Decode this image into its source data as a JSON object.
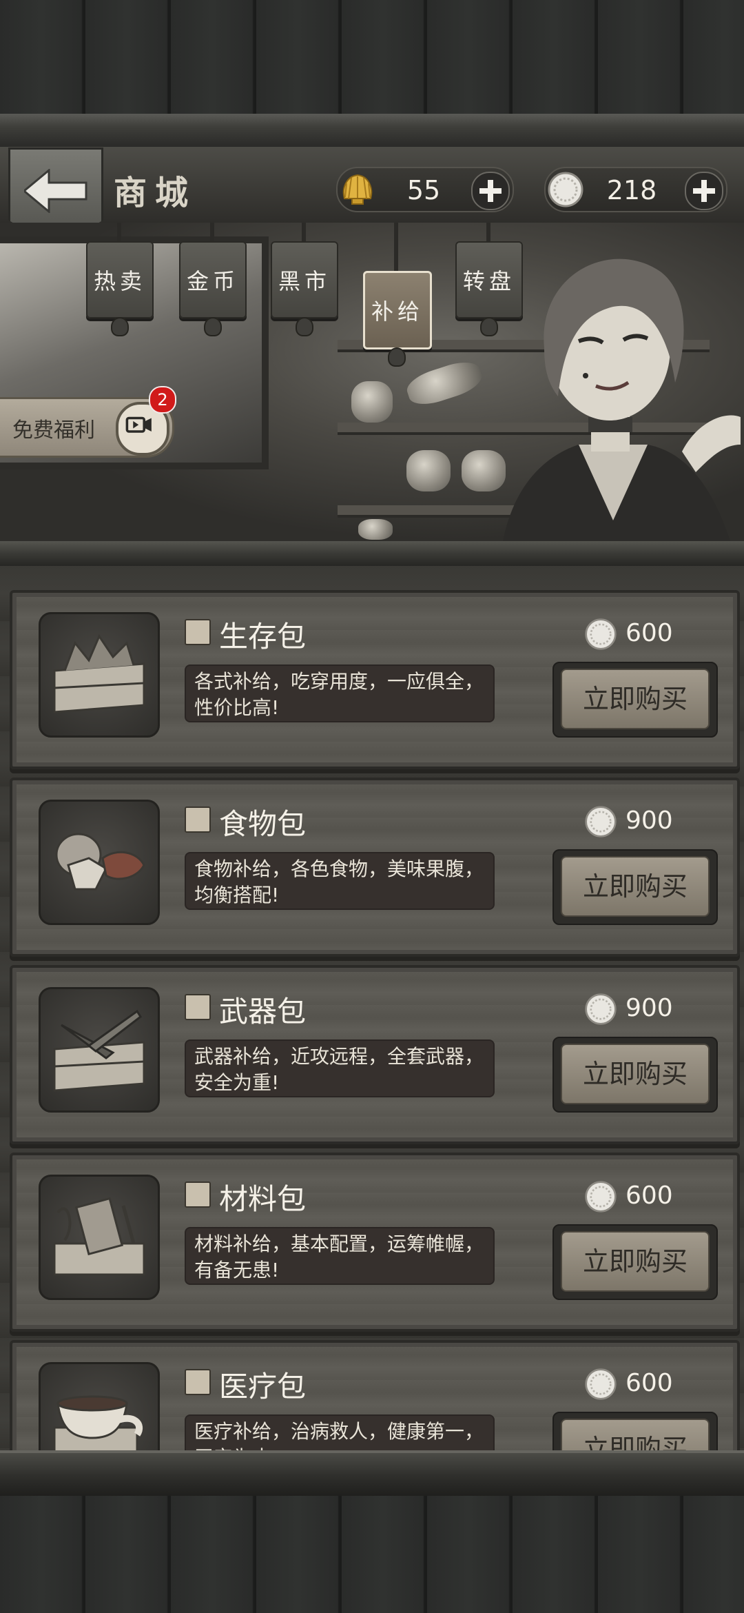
{
  "header": {
    "title": "商城",
    "shells": "55",
    "coins": "218"
  },
  "tabs": [
    {
      "label": "热卖",
      "active": false
    },
    {
      "label": "金币",
      "active": false
    },
    {
      "label": "黑市",
      "active": false
    },
    {
      "label": "补给",
      "active": true
    },
    {
      "label": "转盘",
      "active": false
    }
  ],
  "free_welfare": {
    "label": "免费福利",
    "badge": "2"
  },
  "products": [
    {
      "name": "生存包",
      "price": "600",
      "desc": "各式补给，吃穿用度，一应俱全，性价比高!",
      "buy": "立即购买",
      "icon": "survival-crate-icon"
    },
    {
      "name": "食物包",
      "price": "900",
      "desc": "食物补给，各色食物，美味果腹，均衡搭配!",
      "buy": "立即购买",
      "icon": "food-bundle-icon"
    },
    {
      "name": "武器包",
      "price": "900",
      "desc": "武器补给，近攻远程，全套武器，安全为重!",
      "buy": "立即购买",
      "icon": "weapon-crate-icon"
    },
    {
      "name": "材料包",
      "price": "600",
      "desc": "材料补给，基本配置，运筹帷幄，有备无患!",
      "buy": "立即购买",
      "icon": "material-crate-icon"
    },
    {
      "name": "医疗包",
      "price": "600",
      "desc": "医疗补给，治病救人，健康第一，平安为本!",
      "buy": "立即购买",
      "icon": "medical-bowl-icon"
    }
  ],
  "colors": {
    "accent_badge": "#d11a1a",
    "button": "#a39b8d"
  }
}
